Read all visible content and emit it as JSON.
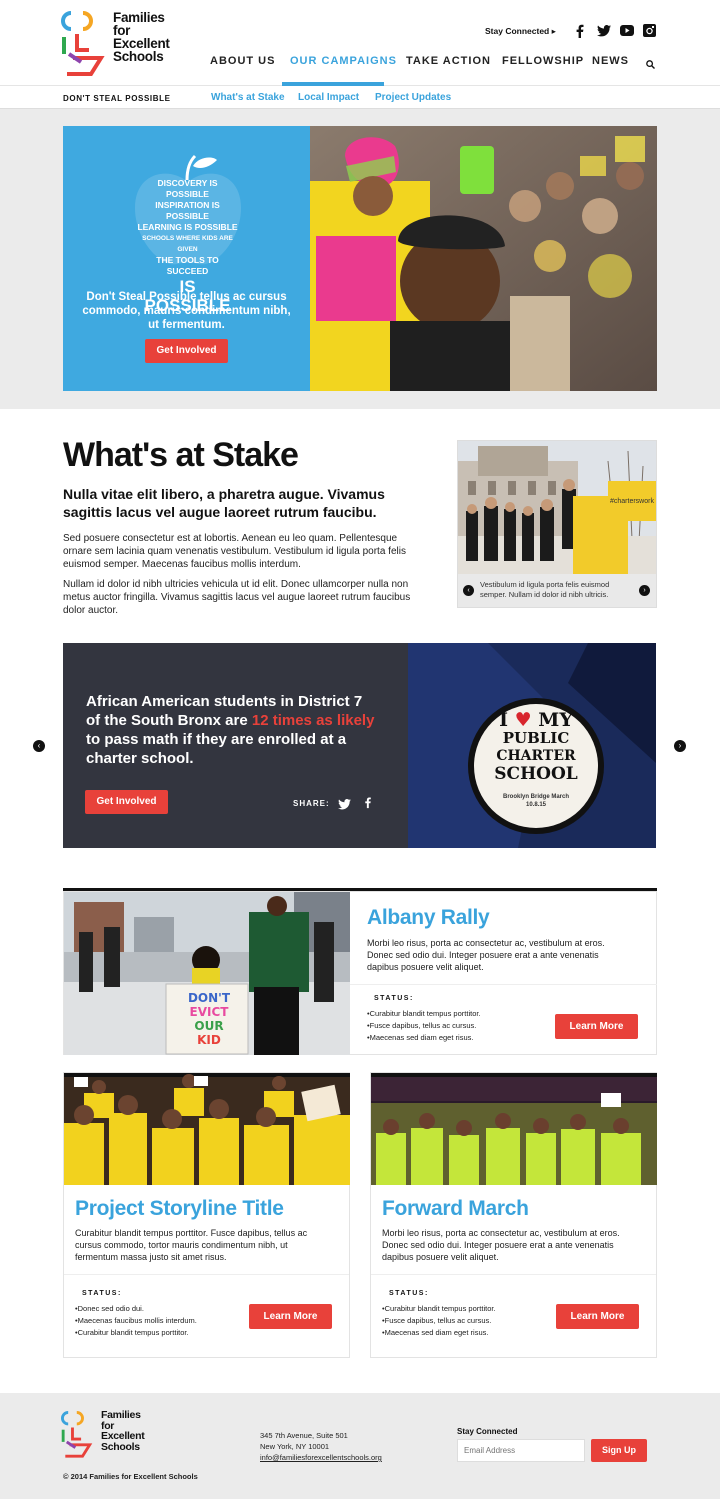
{
  "brand": {
    "name_line1": "Families",
    "name_line2": "for",
    "name_line3": "Excellent",
    "name_line4": "Schools"
  },
  "header": {
    "stay_connected": "Stay Connected",
    "stay_arrow": "▸"
  },
  "nav": {
    "items": [
      "ABOUT US",
      "OUR CAMPAIGNS",
      "TAKE ACTION",
      "FELLOWSHIP",
      "NEWS"
    ],
    "active": "OUR CAMPAIGNS"
  },
  "subnav": {
    "title": "DON'T STEAL POSSIBLE",
    "links": [
      "What's at Stake",
      "Local Impact",
      "Project Updates"
    ]
  },
  "hero": {
    "apple_lines": [
      "DISCOVERY IS POSSIBLE",
      "INSPIRATION IS POSSIBLE",
      "LEARNING IS POSSIBLE",
      "SCHOOLS WHERE KIDS ARE GIVEN",
      "THE TOOLS TO SUCCEED",
      "IS POSSIBLE"
    ],
    "text": "Don't Steal Possible tellus ac cursus commodo, mauris condimentum nibh, ut fermentum.",
    "cta": "Get Involved"
  },
  "stake": {
    "title": "What's at Stake",
    "subtitle": "Nulla vitae elit libero, a pharetra augue. Vivamus sagittis lacus vel augue laoreet rutrum faucibu.",
    "para1": "Sed posuere consectetur est at lobortis. Aenean eu leo quam. Pellentesque ornare sem lacinia quam venenatis vestibulum. Vestibulum id ligula porta felis euismod semper. Maecenas faucibus mollis interdum.",
    "para2": "Nullam id dolor id nibh ultricies vehicula ut id elit. Donec ullamcorper nulla non metus auctor fringilla. Vivamus sagittis lacus vel augue laoreet rutrum faucibus dolor auctor.",
    "gallery_caption": "Vestibulum id ligula porta felis euismod semper. Nullam id dolor id nibh ultricis.",
    "gallery_sign": "#charterswork"
  },
  "stat": {
    "text_before": "African American students in District 7 of the South Bronx are",
    "highlight": "12 times as likely",
    "text_after": "to pass math if they are enrolled at a charter school.",
    "cta": "Get Involved",
    "share_label": "SHARE:",
    "button_line1": "I",
    "button_line1b": "MY",
    "button_line2": "PUBLIC",
    "button_line3": "CHARTER",
    "button_line4": "SCHOOL",
    "button_small": "Brooklyn Bridge March",
    "button_date": "10.8.15"
  },
  "cards": [
    {
      "title": "Albany Rally",
      "desc": "Morbi leo risus, porta ac consectetur ac, vestibulum at eros. Donec sed odio dui. Integer posuere erat a ante venenatis dapibus posuere velit aliquet.",
      "status_label": "STATUS:",
      "status": [
        "Curabitur blandit tempus porttitor.",
        "Fusce dapibus, tellus ac cursus.",
        "Maecenas sed diam eget risus."
      ],
      "cta": "Learn More",
      "sign_lines": [
        "DON'T",
        "EVICT",
        "OUR",
        "KID"
      ]
    },
    {
      "title": "Project Storyline Title",
      "desc": "Curabitur blandit tempus porttitor. Fusce dapibus, tellus ac cursus commodo, tortor mauris condimentum nibh, ut fermentum massa justo sit amet risus.",
      "status_label": "STATUS:",
      "status": [
        "Donec sed odio dui.",
        "Maecenas faucibus mollis interdum.",
        "Curabitur blandit tempus porttitor."
      ],
      "cta": "Learn More"
    },
    {
      "title": "Forward March",
      "desc": "Morbi leo risus, porta ac consectetur ac, vestibulum at eros. Donec sed odio dui. Integer posuere erat a ante venenatis dapibus posuere velit aliquet.",
      "status_label": "STATUS:",
      "status": [
        "Curabitur blandit tempus porttitor.",
        "Fusce dapibus, tellus ac cursus.",
        "Maecenas sed diam eget risus."
      ],
      "cta": "Learn More"
    }
  ],
  "footer": {
    "address1": "345 7th Avenue, Suite 501",
    "address2": "New York, NY 10001",
    "email": "info@familiesforexcellentschools.org",
    "stay_connected": "Stay Connected",
    "email_placeholder": "Email Address",
    "signup": "Sign Up",
    "copyright": "© 2014 Families for Excellent Schools"
  },
  "colors": {
    "accent_blue": "#3aa3dc",
    "accent_red": "#e8413a",
    "dark": "#33353f",
    "band": "#ebebeb"
  }
}
